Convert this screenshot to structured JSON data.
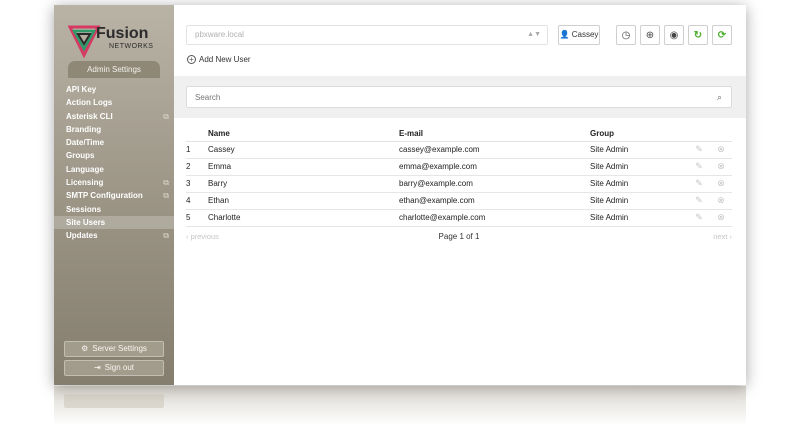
{
  "brand": {
    "name": "Fusion",
    "sub": "NETWORKS"
  },
  "sidebar": {
    "section_tab": "Admin Settings",
    "items": [
      {
        "label": "API Key",
        "external": false,
        "active": false
      },
      {
        "label": "Action Logs",
        "external": false,
        "active": false
      },
      {
        "label": "Asterisk CLI",
        "external": true,
        "active": false
      },
      {
        "label": "Branding",
        "external": false,
        "active": false
      },
      {
        "label": "Date/Time",
        "external": false,
        "active": false
      },
      {
        "label": "Groups",
        "external": false,
        "active": false
      },
      {
        "label": "Language",
        "external": false,
        "active": false
      },
      {
        "label": "Licensing",
        "external": true,
        "active": false
      },
      {
        "label": "SMTP Configuration",
        "external": true,
        "active": false
      },
      {
        "label": "Sessions",
        "external": false,
        "active": false
      },
      {
        "label": "Site Users",
        "external": false,
        "active": true
      },
      {
        "label": "Updates",
        "external": true,
        "active": false
      }
    ],
    "server_settings": "Server Settings",
    "sign_out": "Sign out"
  },
  "header": {
    "host_value": "pbxware.local",
    "user": "Cassey"
  },
  "actions": {
    "add_user": "Add New User"
  },
  "search": {
    "placeholder": "Search"
  },
  "table": {
    "headers": [
      "",
      "Name",
      "E-mail",
      "Group"
    ],
    "rows": [
      {
        "num": "1",
        "name": "Cassey",
        "email": "cassey@example.com",
        "group": "Site Admin"
      },
      {
        "num": "2",
        "name": "Emma",
        "email": "emma@example.com",
        "group": "Site Admin"
      },
      {
        "num": "3",
        "name": "Barry",
        "email": "barry@example.com",
        "group": "Site Admin"
      },
      {
        "num": "4",
        "name": "Ethan",
        "email": "ethan@example.com",
        "group": "Site Admin"
      },
      {
        "num": "5",
        "name": "Charlotte",
        "email": "charlotte@example.com",
        "group": "Site Admin"
      }
    ]
  },
  "pager": {
    "prev": "‹ previous",
    "info": "Page 1 of 1",
    "next": "next ›"
  },
  "colors": {
    "accent_green": "#4caf2e",
    "sidebar_top": "#b9b3a6",
    "sidebar_bottom": "#857e6e"
  }
}
